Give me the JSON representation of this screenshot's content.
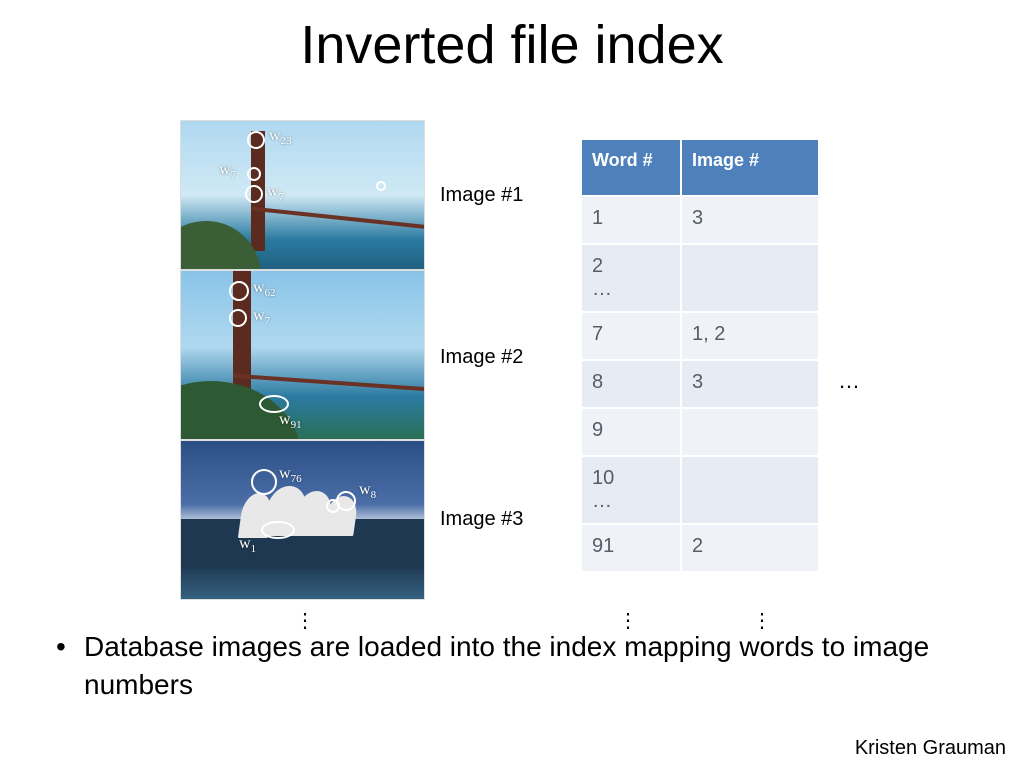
{
  "title": "Inverted file index",
  "db_label": "Database images",
  "images": [
    {
      "label": "Image #1",
      "features": [
        "w23",
        "w7",
        "w7"
      ]
    },
    {
      "label": "Image #2",
      "features": [
        "w62",
        "w7",
        "w91"
      ]
    },
    {
      "label": "Image #3",
      "features": [
        "w76",
        "w8",
        "w1"
      ]
    }
  ],
  "img1_feat_a_pre": "w",
  "img1_feat_a_sub": "23",
  "img1_feat_b_pre": "w",
  "img1_feat_b_sub": "7",
  "img1_feat_c_pre": "w",
  "img1_feat_c_sub": "7",
  "img2_feat_a_pre": "w",
  "img2_feat_a_sub": "62",
  "img2_feat_b_pre": "w",
  "img2_feat_b_sub": "7",
  "img2_feat_c_pre": "w",
  "img2_feat_c_sub": "91",
  "img3_feat_a_pre": "w",
  "img3_feat_a_sub": "76",
  "img3_feat_b_pre": "w",
  "img3_feat_b_sub": "8",
  "img3_feat_c_pre": "w",
  "img3_feat_c_sub": "1",
  "table": {
    "headers": {
      "col1": "Word #",
      "col2": "Image #"
    },
    "rows": [
      {
        "word": "1",
        "images": "3"
      },
      {
        "word": "2\n…",
        "images": ""
      },
      {
        "word": "7",
        "images": "1, 2"
      },
      {
        "word": "8",
        "images": "3"
      },
      {
        "word": "9",
        "images": ""
      },
      {
        "word": "10\n…",
        "images": ""
      },
      {
        "word": "91",
        "images": "2"
      }
    ]
  },
  "ellipsis_h": "…",
  "bullet_text": "Database images are loaded into the index mapping words to image numbers",
  "author": "Kristen Grauman",
  "vdots": "⋮"
}
